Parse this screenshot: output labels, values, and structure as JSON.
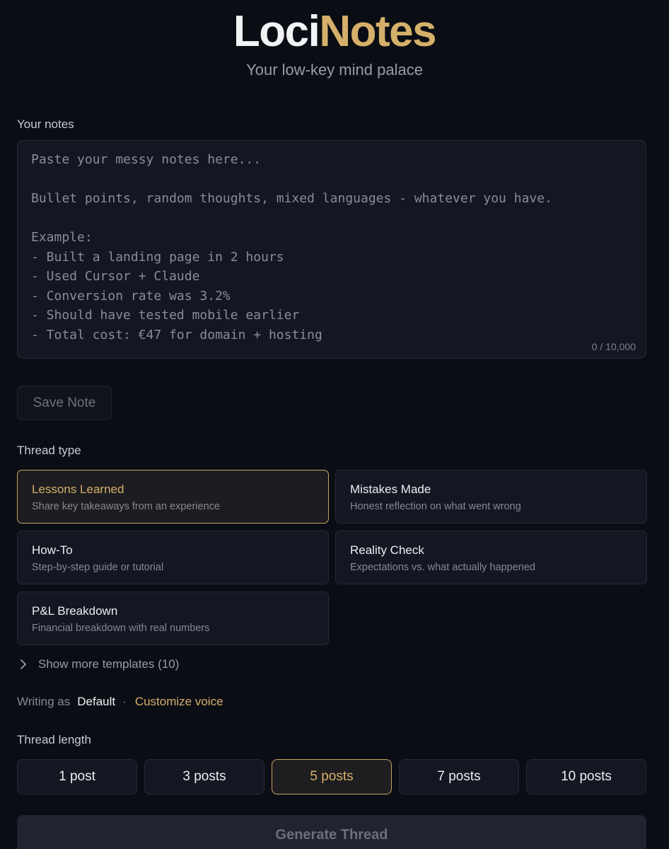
{
  "brand": {
    "part1": "Loci",
    "part2": "Notes"
  },
  "tagline": "Your low-key mind palace",
  "notes": {
    "label": "Your notes",
    "value": "",
    "placeholder": "Paste your messy notes here...\n\nBullet points, random thoughts, mixed languages - whatever you have.\n\nExample:\n- Built a landing page in 2 hours\n- Used Cursor + Claude\n- Conversion rate was 3.2%\n- Should have tested mobile earlier\n- Total cost: €47 for domain + hosting",
    "char_count": "0 / 10,000"
  },
  "save_button": "Save Note",
  "thread_type": {
    "label": "Thread type",
    "selected": "Lessons Learned",
    "options": [
      {
        "title": "Lessons Learned",
        "desc": "Share key takeaways from an experience"
      },
      {
        "title": "Mistakes Made",
        "desc": "Honest reflection on what went wrong"
      },
      {
        "title": "How-To",
        "desc": "Step-by-step guide or tutorial"
      },
      {
        "title": "Reality Check",
        "desc": "Expectations vs. what actually happened"
      },
      {
        "title": "P&L Breakdown",
        "desc": "Financial breakdown with real numbers"
      }
    ],
    "show_more": "Show more templates (10)"
  },
  "voice": {
    "label": "Writing as",
    "value": "Default",
    "separator": "·",
    "customize": "Customize voice"
  },
  "thread_length": {
    "label": "Thread length",
    "selected": "5 posts",
    "options": [
      "1 post",
      "3 posts",
      "5 posts",
      "7 posts",
      "10 posts"
    ]
  },
  "generate_button": "Generate Thread",
  "colors": {
    "background": "#0b0d14",
    "accent": "#d4b06a",
    "card": "#131722"
  }
}
